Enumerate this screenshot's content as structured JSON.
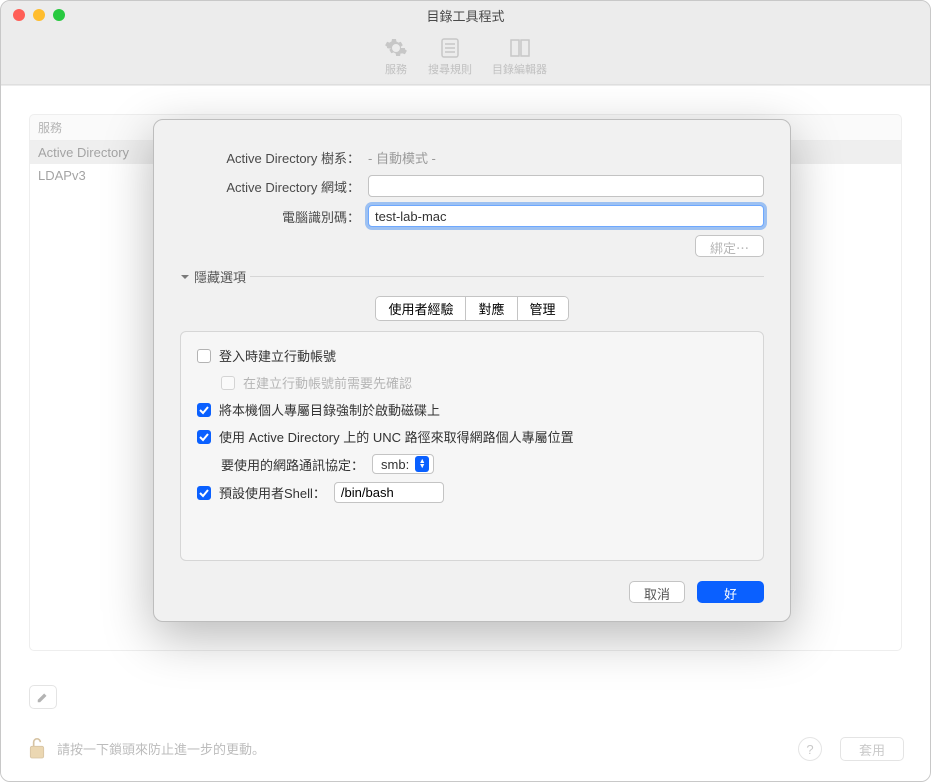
{
  "window": {
    "title": "目錄工具程式"
  },
  "toolbar": {
    "services": "服務",
    "search": "搜尋規則",
    "editor": "目錄編輯器"
  },
  "sidebar": {
    "header": "服務",
    "items": [
      {
        "label": "Active Directory"
      },
      {
        "label": "LDAPv3"
      }
    ]
  },
  "sheet": {
    "forest_label": "Active Directory 樹系：",
    "forest_value": "- 自動模式 -",
    "domain_label": "Active Directory 網域：",
    "domain_value": "",
    "computer_label": "電腦識別碼：",
    "computer_value": "test-lab-mac",
    "bind_button": "綁定⋯",
    "hide_options": "隱藏選項",
    "tabs": {
      "ux": "使用者經驗",
      "map": "對應",
      "admin": "管理"
    },
    "opts": {
      "create_mobile": "登入時建立行動帳號",
      "confirm_mobile": "在建立行動帳號前需要先確認",
      "force_home": "將本機個人專屬目錄強制於啟動磁碟上",
      "use_unc": "使用 Active Directory 上的 UNC 路徑來取得網路個人專屬位置",
      "proto_label": "要使用的網路通訊協定：",
      "proto_value": "smb:",
      "shell_label": "預設使用者Shell：",
      "shell_value": "/bin/bash"
    },
    "cancel": "取消",
    "ok": "好"
  },
  "footer": {
    "lock_text": "請按一下鎖頭來防止進一步的更動。",
    "help": "?",
    "apply": "套用"
  }
}
